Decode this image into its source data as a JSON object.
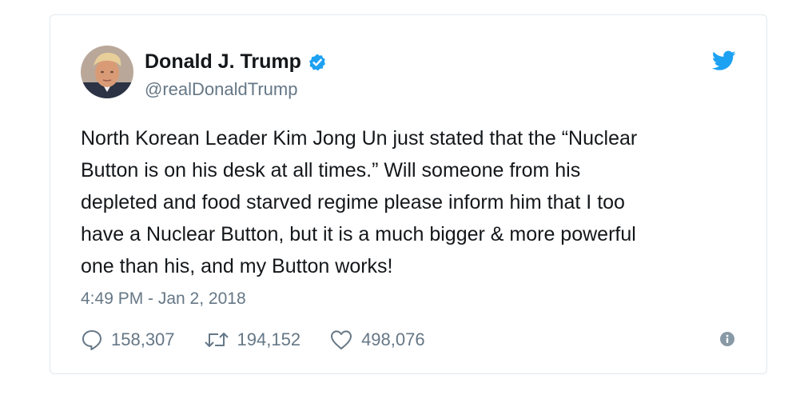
{
  "user": {
    "name": "Donald J. Trump",
    "handle": "@realDonaldTrump",
    "verified_icon": "verified-badge-icon",
    "avatar": "profile-avatar"
  },
  "tweet": {
    "text": "North Korean Leader Kim Jong Un just stated that the “Nuclear\nButton is on his desk at all times.” Will someone from his\ndepleted and food starved regime please inform him that I too\nhave a Nuclear Button, but it is a much bigger & more powerful\none than his, and my Button works!",
    "timestamp": "4:49 PM - Jan 2, 2018"
  },
  "actions": {
    "replies": "158,307",
    "retweets": "194,152",
    "likes": "498,076"
  },
  "icons": {
    "brand": "twitter-bird-icon",
    "reply": "reply-bubble-icon",
    "retweet": "retweet-icon",
    "like": "heart-icon",
    "info": "info-icon"
  },
  "colors": {
    "brand": "#1da1f2",
    "text": "#14171a",
    "secondary": "#657786",
    "border": "#e1e8ed"
  }
}
